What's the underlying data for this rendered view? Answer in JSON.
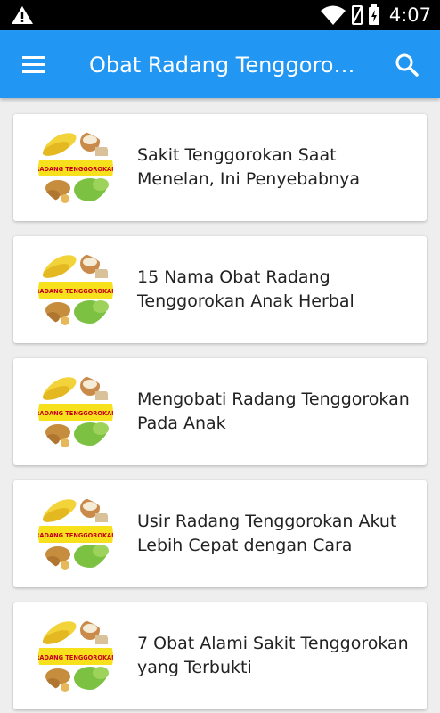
{
  "status_bar": {
    "time": "4:07",
    "icons": [
      "warning-icon",
      "wifi-icon",
      "no-sim-icon",
      "battery-icon"
    ]
  },
  "app_bar": {
    "title": "Obat Radang Tenggorokan",
    "menu_icon": "hamburger-menu-icon",
    "search_icon": "search-icon",
    "color": "#2196f3"
  },
  "articles": [
    {
      "title": "Sakit Tenggorokan Saat Menelan, Ini Penyebabnya",
      "thumb_text": "RADANG TENGGOROKAN"
    },
    {
      "title": "15 Nama Obat Radang Tenggorokan Anak Herbal",
      "thumb_text": "RADANG TENGGOROKAN"
    },
    {
      "title": "Mengobati Radang Tenggorokan Pada Anak",
      "thumb_text": "RADANG TENGGOROKAN"
    },
    {
      "title": "Usir Radang Tenggorokan Akut Lebih Cepat dengan Cara",
      "thumb_text": "RADANG TENGGOROKAN"
    },
    {
      "title": "7 Obat Alami Sakit Tenggorokan yang Terbukti",
      "thumb_text": "RADANG TENGGOROKAN"
    }
  ]
}
